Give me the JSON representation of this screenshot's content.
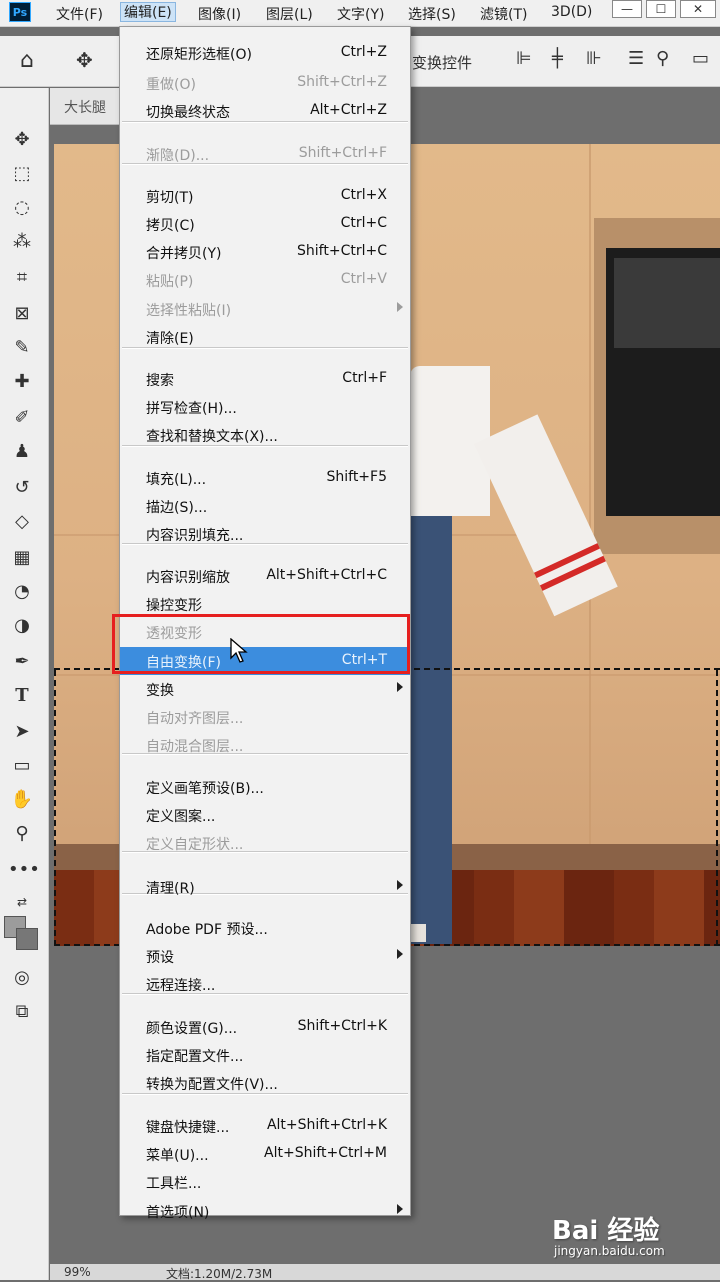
{
  "menubar": {
    "logo": "Ps",
    "items": [
      "文件(F)",
      "编辑(E)",
      "图像(I)",
      "图层(L)",
      "文字(Y)",
      "选择(S)",
      "滤镜(T)",
      "3D(D)"
    ]
  },
  "options_bar": {
    "transform_controls": "变换控件"
  },
  "document_tab": {
    "title": "大长腿"
  },
  "status_bar": {
    "zoom": "99%",
    "doc_info": "文档:1.20M/2.73M"
  },
  "edit_menu": {
    "items": [
      {
        "label": "还原矩形选框(O)",
        "shortcut": "Ctrl+Z",
        "enabled": true
      },
      {
        "label": "重做(O)",
        "shortcut": "Shift+Ctrl+Z",
        "enabled": false
      },
      {
        "label": "切换最终状态",
        "shortcut": "Alt+Ctrl+Z",
        "enabled": true
      },
      {
        "label": "渐隐(D)...",
        "shortcut": "Shift+Ctrl+F",
        "enabled": false
      },
      {
        "label": "剪切(T)",
        "shortcut": "Ctrl+X",
        "enabled": true
      },
      {
        "label": "拷贝(C)",
        "shortcut": "Ctrl+C",
        "enabled": true
      },
      {
        "label": "合并拷贝(Y)",
        "shortcut": "Shift+Ctrl+C",
        "enabled": true
      },
      {
        "label": "粘贴(P)",
        "shortcut": "Ctrl+V",
        "enabled": false
      },
      {
        "label": "选择性粘贴(I)",
        "shortcut": "",
        "enabled": false,
        "submenu": true
      },
      {
        "label": "清除(E)",
        "shortcut": "",
        "enabled": true
      },
      {
        "label": "搜索",
        "shortcut": "Ctrl+F",
        "enabled": true
      },
      {
        "label": "拼写检查(H)...",
        "shortcut": "",
        "enabled": true
      },
      {
        "label": "查找和替换文本(X)...",
        "shortcut": "",
        "enabled": true
      },
      {
        "label": "填充(L)...",
        "shortcut": "Shift+F5",
        "enabled": true
      },
      {
        "label": "描边(S)...",
        "shortcut": "",
        "enabled": true
      },
      {
        "label": "内容识别填充...",
        "shortcut": "",
        "enabled": true
      },
      {
        "label": "内容识别缩放",
        "shortcut": "Alt+Shift+Ctrl+C",
        "enabled": true
      },
      {
        "label": "操控变形",
        "shortcut": "",
        "enabled": true
      },
      {
        "label": "透视变形",
        "shortcut": "",
        "enabled": false
      },
      {
        "label": "自由变换(F)",
        "shortcut": "Ctrl+T",
        "enabled": true,
        "highlighted": true
      },
      {
        "label": "变换",
        "shortcut": "",
        "enabled": true,
        "submenu": true
      },
      {
        "label": "自动对齐图层...",
        "shortcut": "",
        "enabled": false
      },
      {
        "label": "自动混合图层...",
        "shortcut": "",
        "enabled": false
      },
      {
        "label": "定义画笔预设(B)...",
        "shortcut": "",
        "enabled": true
      },
      {
        "label": "定义图案...",
        "shortcut": "",
        "enabled": true
      },
      {
        "label": "定义自定形状...",
        "shortcut": "",
        "enabled": false
      },
      {
        "label": "清理(R)",
        "shortcut": "",
        "enabled": true,
        "submenu": true
      },
      {
        "label": "Adobe PDF 预设...",
        "shortcut": "",
        "enabled": true
      },
      {
        "label": "预设",
        "shortcut": "",
        "enabled": true,
        "submenu": true
      },
      {
        "label": "远程连接...",
        "shortcut": "",
        "enabled": true
      },
      {
        "label": "颜色设置(G)...",
        "shortcut": "Shift+Ctrl+K",
        "enabled": true
      },
      {
        "label": "指定配置文件...",
        "shortcut": "",
        "enabled": true
      },
      {
        "label": "转换为配置文件(V)...",
        "shortcut": "",
        "enabled": true
      },
      {
        "label": "键盘快捷键...",
        "shortcut": "Alt+Shift+Ctrl+K",
        "enabled": true
      },
      {
        "label": "菜单(U)...",
        "shortcut": "Alt+Shift+Ctrl+M",
        "enabled": true
      },
      {
        "label": "工具栏...",
        "shortcut": "",
        "enabled": true
      },
      {
        "label": "首选项(N)",
        "shortcut": "",
        "enabled": true,
        "submenu": true
      }
    ]
  },
  "watermark": {
    "brand": "Bai 经验",
    "url": "jingyan.baidu.com"
  },
  "colors": {
    "highlight": "#3c8dde",
    "annotation_box": "#e61f1f",
    "menu_bg": "#f2f2f2"
  }
}
